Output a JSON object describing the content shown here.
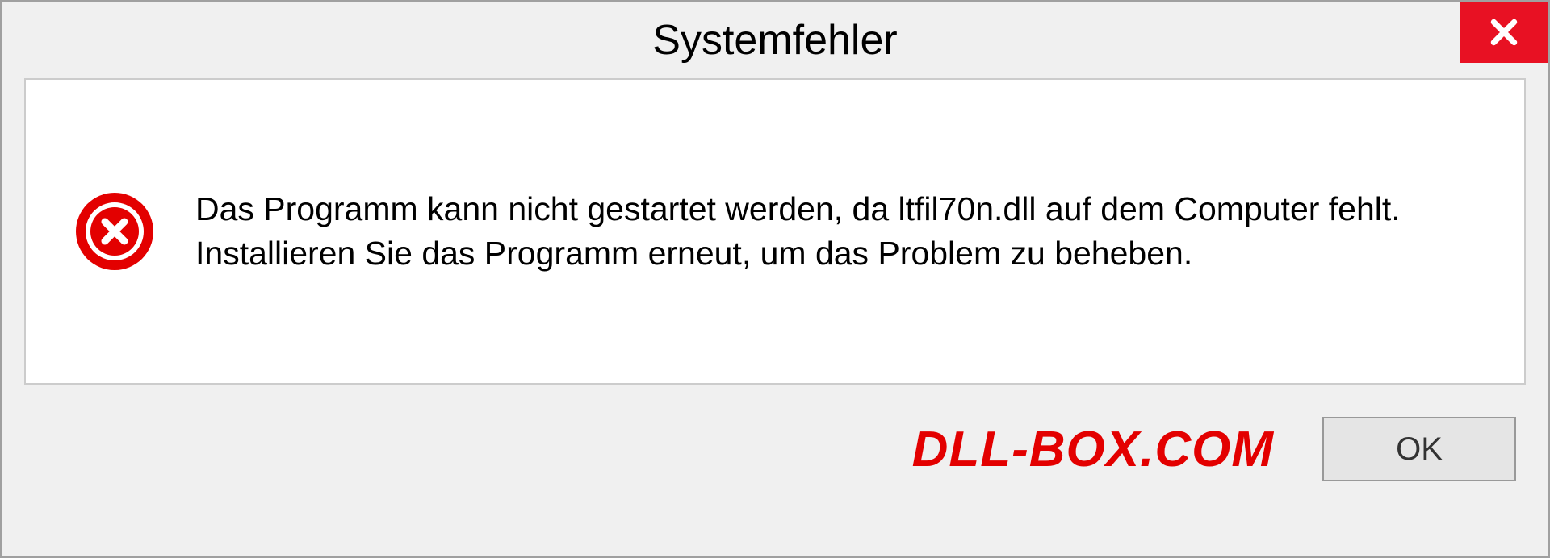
{
  "dialog": {
    "title": "Systemfehler",
    "message": "Das Programm kann nicht gestartet werden, da ltfil70n.dll auf dem Computer fehlt. Installieren Sie das Programm erneut, um das Problem zu beheben.",
    "ok_label": "OK"
  },
  "watermark": "DLL-BOX.COM",
  "colors": {
    "close_bg": "#e81123",
    "error_icon": "#e30000",
    "watermark": "#e30000"
  }
}
